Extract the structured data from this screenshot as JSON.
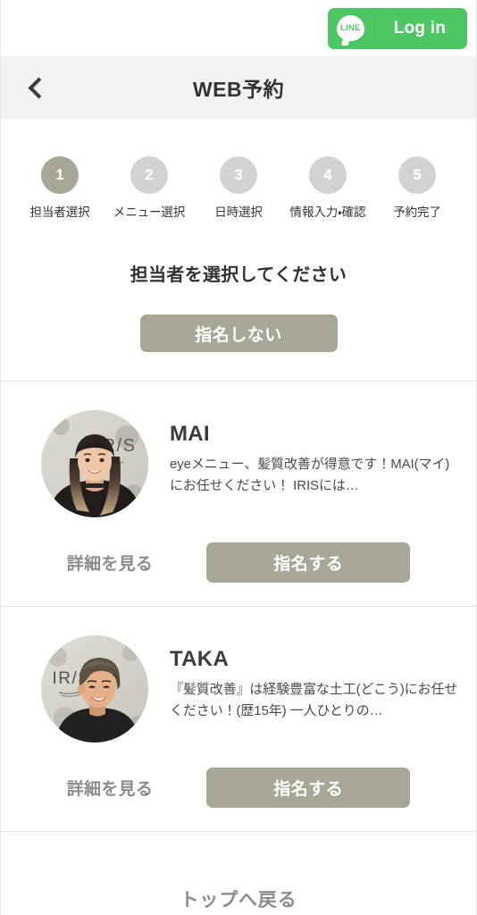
{
  "topbar": {
    "line_login": {
      "logo_text": "LINE",
      "label": "Log in",
      "color": "#4cc764"
    }
  },
  "header": {
    "back_icon": "chevron-left-icon",
    "title": "WEB予約"
  },
  "stepper": {
    "active_index": 1,
    "active_color": "#a8a694",
    "inactive_color": "#d2d2d2",
    "steps": [
      {
        "number": "1",
        "label": "担当者選択"
      },
      {
        "number": "2",
        "label": "メニュー選択"
      },
      {
        "number": "3",
        "label": "日時選択"
      },
      {
        "number": "4",
        "label": "情報入力・確認"
      },
      {
        "number": "5",
        "label": "予約完了"
      }
    ]
  },
  "select_section": {
    "heading": "担当者を選択してください",
    "no_preference_label": "指名しない"
  },
  "staff": [
    {
      "name": "MAI",
      "description": "eyeメニュー、髪質改善が得意です！MAI(マイ)にお任せください！ IRISには…",
      "detail_label": "詳細を見る",
      "assign_label": "指名する",
      "avatar_alt": "MAIのプロフィール写真"
    },
    {
      "name": "TAKA",
      "description": "『髪質改善』は経験豊富な土工(どこう)にお任せください！(歴15年) 一人ひとりの…",
      "detail_label": "詳細を見る",
      "assign_label": "指名する",
      "avatar_alt": "TAKAのプロフィール写真"
    }
  ],
  "footer": {
    "top_link_label": "トップへ戻る"
  },
  "theme": {
    "accent": "#a8a694",
    "header_bg": "#f2f2f2",
    "divider": "#e2e2e2",
    "muted_text": "#8c8c8c"
  }
}
